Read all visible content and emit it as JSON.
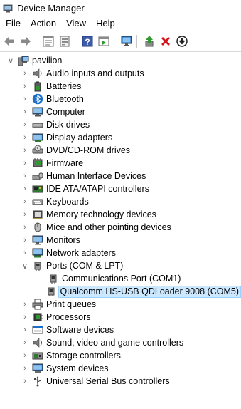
{
  "window": {
    "title": "Device Manager"
  },
  "menu": {
    "items": [
      "File",
      "Action",
      "View",
      "Help"
    ]
  },
  "toolbar": {
    "buttons": [
      "back-arrow-icon",
      "forward-arrow-icon",
      "properties-icon",
      "tree-view-icon",
      "help-icon",
      "driver-icon",
      "scan-monitor-icon",
      "update-driver-icon",
      "uninstall-icon",
      "disable-icon"
    ]
  },
  "tree": {
    "root": "pavilion",
    "categories": [
      {
        "label": "Audio inputs and outputs",
        "icon": "speaker-icon",
        "expanded": false
      },
      {
        "label": "Batteries",
        "icon": "battery-icon",
        "expanded": false
      },
      {
        "label": "Bluetooth",
        "icon": "bluetooth-icon",
        "expanded": false
      },
      {
        "label": "Computer",
        "icon": "computer-icon",
        "expanded": false
      },
      {
        "label": "Disk drives",
        "icon": "disk-drive-icon",
        "expanded": false
      },
      {
        "label": "Display adapters",
        "icon": "display-adapter-icon",
        "expanded": false
      },
      {
        "label": "DVD/CD-ROM drives",
        "icon": "dvd-icon",
        "expanded": false
      },
      {
        "label": "Firmware",
        "icon": "firmware-icon",
        "expanded": false
      },
      {
        "label": "Human Interface Devices",
        "icon": "hid-icon",
        "expanded": false
      },
      {
        "label": "IDE ATA/ATAPI controllers",
        "icon": "ide-controller-icon",
        "expanded": false
      },
      {
        "label": "Keyboards",
        "icon": "keyboard-icon",
        "expanded": false
      },
      {
        "label": "Memory technology devices",
        "icon": "memory-icon",
        "expanded": false
      },
      {
        "label": "Mice and other pointing devices",
        "icon": "mouse-icon",
        "expanded": false
      },
      {
        "label": "Monitors",
        "icon": "monitor-icon",
        "expanded": false
      },
      {
        "label": "Network adapters",
        "icon": "network-adapter-icon",
        "expanded": false
      },
      {
        "label": "Ports (COM & LPT)",
        "icon": "port-icon",
        "expanded": true,
        "children": [
          {
            "label": "Communications Port (COM1)",
            "icon": "port-icon",
            "selected": false
          },
          {
            "label": "Qualcomm HS-USB QDLoader 9008 (COM5)",
            "icon": "port-icon",
            "selected": true
          }
        ]
      },
      {
        "label": "Print queues",
        "icon": "printer-icon",
        "expanded": false
      },
      {
        "label": "Processors",
        "icon": "processor-icon",
        "expanded": false
      },
      {
        "label": "Software devices",
        "icon": "software-device-icon",
        "expanded": false
      },
      {
        "label": "Sound, video and game controllers",
        "icon": "sound-icon",
        "expanded": false
      },
      {
        "label": "Storage controllers",
        "icon": "storage-controller-icon",
        "expanded": false
      },
      {
        "label": "System devices",
        "icon": "system-device-icon",
        "expanded": false
      },
      {
        "label": "Universal Serial Bus controllers",
        "icon": "usb-icon",
        "expanded": false
      }
    ]
  },
  "colors": {
    "selection_bg": "#cce8ff",
    "selection_border": "#99d1ff",
    "accent_blue": "#1a6fc9",
    "delete_red": "#d4141b",
    "update_green": "#2e9a2e"
  }
}
